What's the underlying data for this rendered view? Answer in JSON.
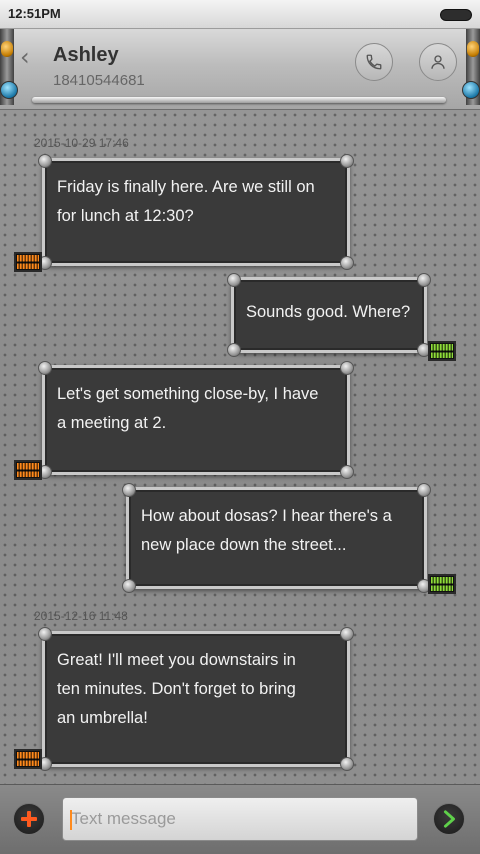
{
  "status_bar": {
    "time": "12:51PM"
  },
  "header": {
    "contact_name": "Ashley",
    "contact_number": "18410544681",
    "call_icon": "phone-icon",
    "contact_icon": "person-icon"
  },
  "conversation": {
    "timestamps": [
      "2015-10-29 17:46",
      "2015-12-16 11:48"
    ],
    "messages": [
      {
        "direction": "incoming",
        "text_lines": [
          "Friday is finally here. Are we still on",
          "for lunch at 12:30?"
        ]
      },
      {
        "direction": "outgoing",
        "text_lines": [
          "Sounds good. Where?"
        ]
      },
      {
        "direction": "incoming",
        "text_lines": [
          "Let's get something close-by, I have",
          "a meeting at 2."
        ]
      },
      {
        "direction": "outgoing",
        "text_lines": [
          "How about dosas? I hear there's a",
          "new place down the street..."
        ]
      },
      {
        "direction": "incoming",
        "text_lines": [
          "Great! I'll meet you downstairs in",
          "ten minutes. Don't forget to bring",
          "an umbrella!"
        ]
      }
    ]
  },
  "compose": {
    "placeholder": "Text message",
    "add_icon": "plus-icon",
    "send_icon": "send-arrow-icon"
  },
  "colors": {
    "incoming_status": "#ff8a1c",
    "outgoing_status": "#8fdc3a",
    "bubble_fill": "#3a3a3a",
    "add_icon": "#ff5a1f",
    "send_icon": "#5fd14a"
  }
}
